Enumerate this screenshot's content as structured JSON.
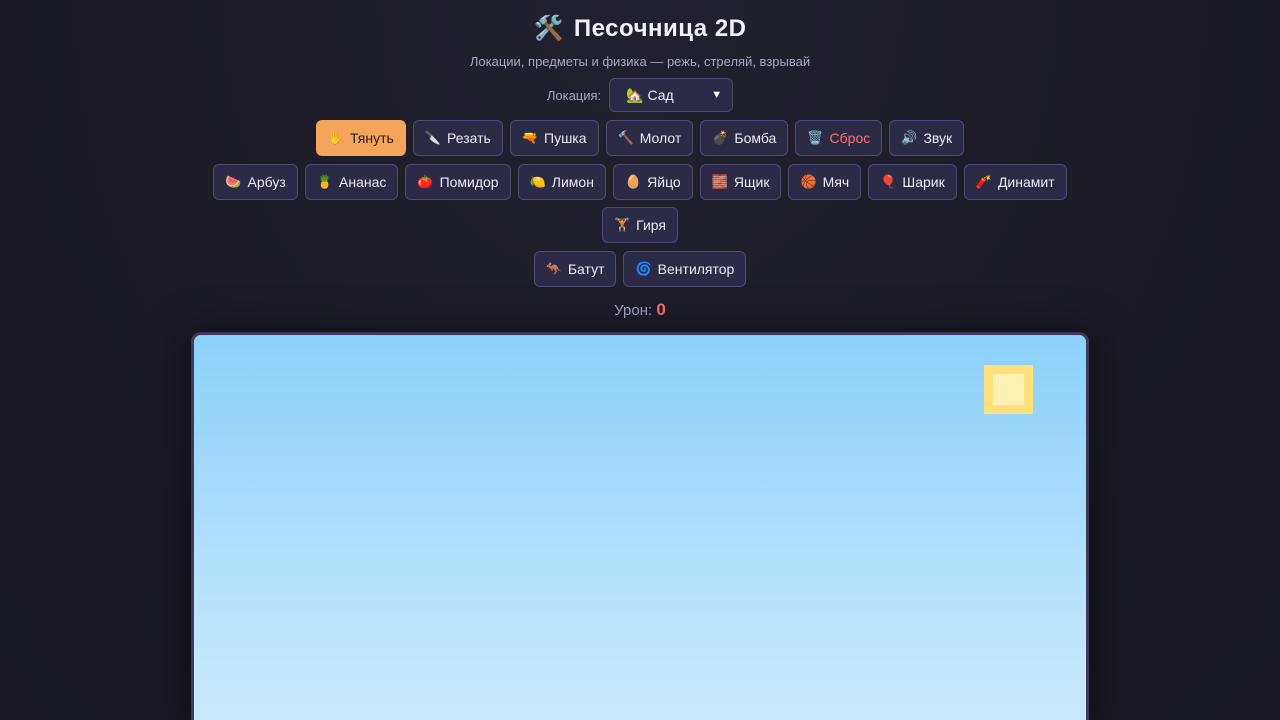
{
  "header": {
    "title_emoji": "🛠️",
    "title": "Песочница 2D",
    "subtitle": "Локации, предметы и физика — режь, стреляй, взрывай"
  },
  "location": {
    "label": "Локация:",
    "selected_icon": "🏡",
    "selected": "Сад"
  },
  "tools": [
    {
      "icon": "✋",
      "label": "Тянуть",
      "active": true
    },
    {
      "icon": "🔪",
      "label": "Резать"
    },
    {
      "icon": "🔫",
      "label": "Пушка"
    },
    {
      "icon": "🔨",
      "label": "Молот"
    },
    {
      "icon": "💣",
      "label": "Бомба"
    },
    {
      "icon": "🗑️",
      "label": "Сброс",
      "danger": true
    },
    {
      "icon": "🔊",
      "label": "Звук"
    }
  ],
  "items": [
    {
      "icon": "🍉",
      "label": "Арбуз"
    },
    {
      "icon": "🍍",
      "label": "Ананас"
    },
    {
      "icon": "🍅",
      "label": "Помидор"
    },
    {
      "icon": "🍋",
      "label": "Лимон"
    },
    {
      "icon": "🥚",
      "label": "Яйцо"
    },
    {
      "icon": "🧱",
      "label": "Ящик"
    },
    {
      "icon": "🏀",
      "label": "Мяч"
    },
    {
      "icon": "🎈",
      "label": "Шарик"
    },
    {
      "icon": "🧨",
      "label": "Динамит"
    },
    {
      "icon": "🏋️",
      "label": "Гиря"
    }
  ],
  "props": [
    {
      "icon": "🦘",
      "label": "Батут"
    },
    {
      "icon": "🌀",
      "label": "Вентилятор"
    }
  ],
  "status": {
    "damage_label": "Урон:",
    "damage_value": "0"
  },
  "colors": {
    "accent": "#f5a45c",
    "danger": "#ff6e6e",
    "sky_top": "#8bd0fb",
    "sun": "#fde07c"
  }
}
